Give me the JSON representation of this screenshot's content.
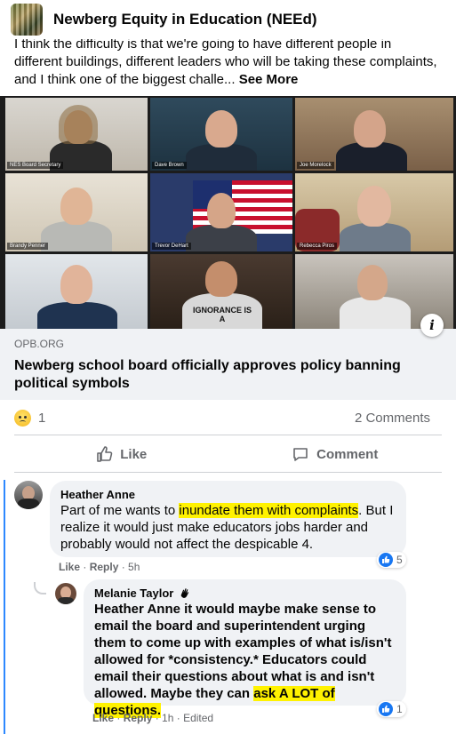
{
  "header": {
    "group_title": "Newberg Equity in Education (NEEd)"
  },
  "post": {
    "text": "I think the difficulty is that we're going to have different people in different buildings, different leaders who will be taking these complaints, and I think one of the biggest challe...",
    "see_more": "See More"
  },
  "video": {
    "nameplates": [
      "NES Board Secretary",
      "Dave Brown",
      "Joe Morelock",
      "Brandy Penner",
      "Trevor DeHart",
      "Rebecca Piros"
    ],
    "shirt_text": "IGNORANCE IS A"
  },
  "link": {
    "domain": "OPB.ORG",
    "title": "Newberg school board officially approves policy banning political symbols"
  },
  "stats": {
    "reaction_count": "1",
    "comments": "2 Comments"
  },
  "actions": {
    "like": "Like",
    "comment": "Comment"
  },
  "comments": [
    {
      "author": "Heather Anne",
      "text_before": "Part of me wants to ",
      "highlight": "inundate them with complaints",
      "text_after": ". But I realize it would just make educators jobs harder and probably would not affect the despicable 4.",
      "like": "Like",
      "reply": "Reply",
      "time": "5h",
      "likes": "5"
    },
    {
      "author": "Melanie Taylor",
      "mention": "Heather Anne",
      "text_before": " it would maybe make sense to email the board and superintendent urging them to come up with examples of what is/isn't allowed for *consistency.* Educators could email their questions about what is and isn't allowed. Maybe they can ",
      "highlight": "ask A LOT of questions.",
      "like": "Like",
      "reply": "Reply",
      "time": "1h",
      "edited": "Edited",
      "likes": "1"
    }
  ],
  "colors": {
    "accent": "#1877f2",
    "thread_line": "#2d88ff",
    "highlight": "#fff200",
    "card_bg": "#f0f2f5"
  }
}
